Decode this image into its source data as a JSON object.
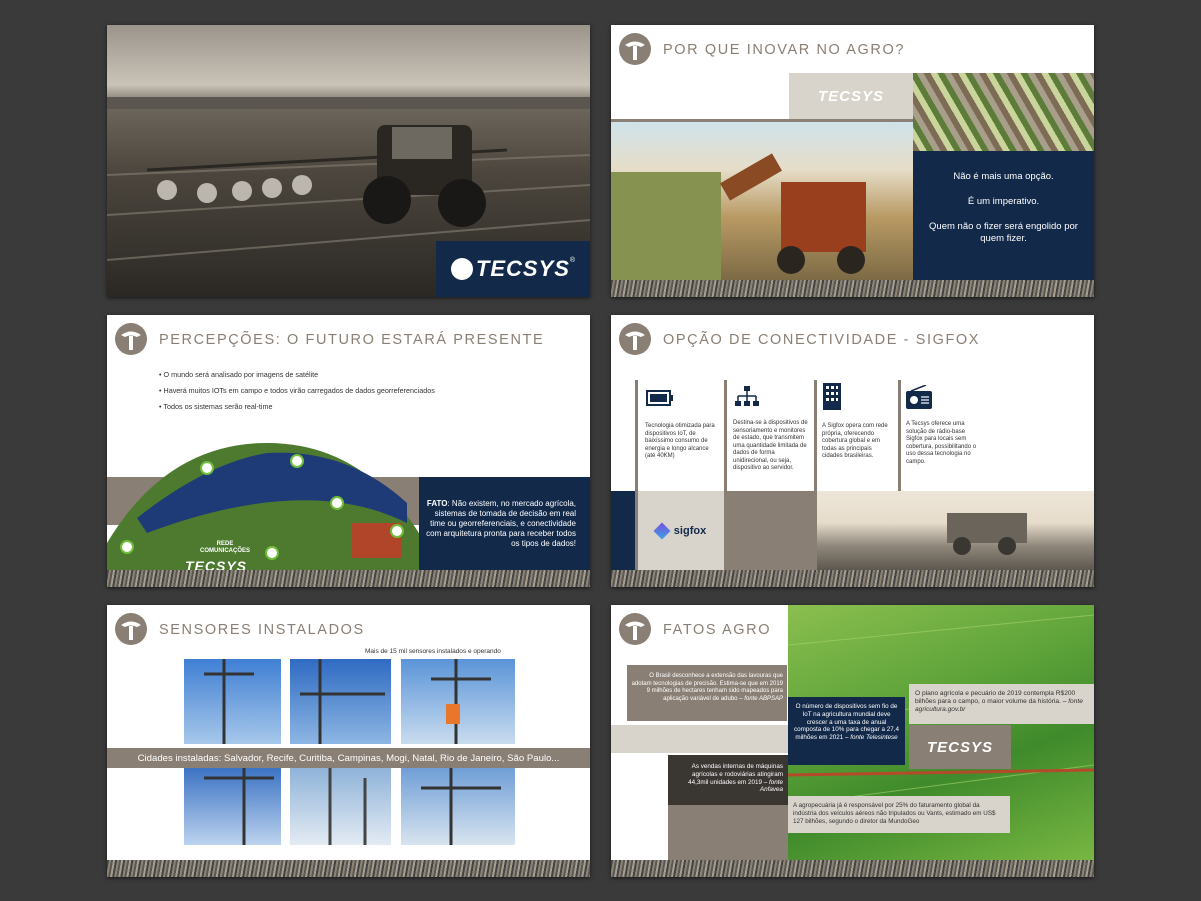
{
  "colors": {
    "navy": "#12294a",
    "taupe": "#8a7f74",
    "beige": "#c8bfb0"
  },
  "brand": {
    "name": "TECSYS",
    "reg": "®"
  },
  "s2": {
    "title": "POR QUE INOVAR NO AGRO?",
    "lines": [
      "Não é mais uma opção.",
      "É um imperativo.",
      "Quem não o fizer será engolido por quem fizer."
    ]
  },
  "s3": {
    "title": "PERCEPÇÕES: O FUTURO ESTARÁ PRESENTE",
    "bullets": [
      "O mundo será analisado por imagens de satélite",
      "Haverá muitos IOTs em campo e todos virão carregados de dados georreferenciados",
      "Todos os sistemas serão real-time"
    ],
    "fact_label": "FATO",
    "fact": ": Não existem, no mercado agrícola, sistemas de tomada de decisão em real time ou georreferenciais, e conectividade com arquitetura pronta para receber todos os tipos de dados!",
    "network": "REDE COMUNICAÇÕES"
  },
  "s4": {
    "title": "OPÇÃO DE CONECTIVIDADE - SIGFOX",
    "cols": [
      {
        "icon": "battery-icon",
        "text": "Tecnologia otimizada para dispositivos IoT, de baixíssimo consumo de energia e longo alcance (até 40KM)"
      },
      {
        "icon": "network-icon",
        "text": "Destina-se à dispositivos de sensoriamento e monitores de estado, que transmitem uma quantidade limitada de dados de forma unidirecional, ou seja, dispositivo ao servidor."
      },
      {
        "icon": "building-icon",
        "text": "A Sigfox opera com rede própria, oferecendo cobertura global e em todas as principais cidades brasileiras."
      },
      {
        "icon": "radio-icon",
        "text": "A Tecsys oferece uma solução de rádio-base Sigfox para locais sem cobertura, possibilitando o uso dessa tecnologia no campo."
      }
    ],
    "sigfox": "sigfox"
  },
  "s5": {
    "title": "SENSORES INSTALADOS",
    "caption": "Mais de 15 mil sensores instalados e operando",
    "cities": "Cidades instaladas: Salvador, Recife, Curitiba, Campinas, Mogi, Natal, Rio de Janeiro, São Paulo..."
  },
  "s6": {
    "title": "FATOS AGRO",
    "f1": "O Brasil desconhece a extensão das lavouras que adotam tecnologias de precisão. Estima-se que em 2019 9 milhões de hectares tenham sido mapeados para aplicação variável de adubo",
    "f1_src": "– fonte ABPSAP",
    "f2": "O número de dispositivos sem fio de IoT na agricultura mundial deve crescer a uma taxa de anual composta de 10% para chegar a 27,4 milhões em 2021",
    "f2_src": "– fonte Telesintese",
    "f3": "O plano agrícola e pecuário de 2019 contempla R$200 bilhões para o campo, o maior volume da história.",
    "f3_src": "– fonte agricultura.gov.br",
    "f4": "As vendas internas de máquinas agrícolas e rodoviárias atingiram 44,3mil unidades em 2019",
    "f4_src": "– fonte Anfavea",
    "f5": "A agropecuária já é responsável por 25% do faturamento global da indústria dos veículos aéreos não tripulados ou Vants, estimado em US$ 127 bilhões, segundo o diretor da MundoGeo"
  }
}
